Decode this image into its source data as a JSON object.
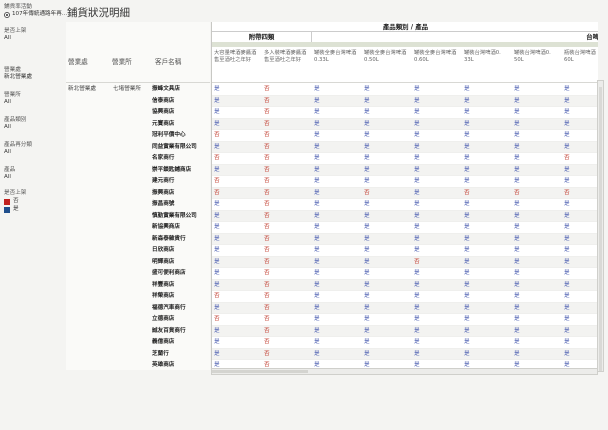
{
  "title": "鋪貨狀況明細",
  "filters": {
    "activity": {
      "label": "鋪貨率活動",
      "selected": "107年傳統通路年再..."
    },
    "launch": {
      "label": "是否上架",
      "value": "All"
    },
    "region": {
      "label": "營業處",
      "value": "新北營業處"
    },
    "office": {
      "label": "營業所",
      "value": "All"
    },
    "category": {
      "label": "產品類別",
      "value": "All"
    },
    "subcategory": {
      "label": "產品再分類",
      "value": "All"
    },
    "product": {
      "label": "產品",
      "value": "All"
    },
    "legend": {
      "label": "是否上架",
      "items": [
        {
          "label": "否",
          "color": "#c0211f"
        },
        {
          "label": "是",
          "color": "#1f4e8c"
        }
      ]
    }
  },
  "table": {
    "row_headers": [
      "營業處",
      "營業所",
      "客戶名稱"
    ],
    "region": "新北營業處",
    "office": "七堵營業所",
    "group_header": "產品類別 / 產品",
    "categories": [
      "附帶四類",
      "台啤"
    ],
    "products": [
      "大容量啤酒麥醬酒\n售至酒吐之年好",
      "多入裝啤酒麥醬酒\n售至酒吐之年好",
      "罐裝全麥台灣啤酒\n0.33L",
      "罐裝全麥台灣啤酒\n0.50L",
      "罐裝全麥台灣啤酒\n0.60L",
      "罐裝台灣啤酒0.\n33L",
      "罐裝台灣啤酒0.\n50L",
      "瓶裝台灣啤酒\n60L"
    ],
    "rows": [
      {
        "customer": "振峰文具店",
        "values": [
          "是",
          "否",
          "是",
          "是",
          "是",
          "是",
          "是",
          "是"
        ]
      },
      {
        "customer": "信泰商店",
        "values": [
          "是",
          "否",
          "是",
          "是",
          "是",
          "是",
          "是",
          "是"
        ]
      },
      {
        "customer": "協興商店",
        "values": [
          "是",
          "否",
          "是",
          "是",
          "是",
          "是",
          "是",
          "是"
        ]
      },
      {
        "customer": "元寶商店",
        "values": [
          "是",
          "否",
          "是",
          "是",
          "是",
          "是",
          "是",
          "是"
        ]
      },
      {
        "customer": "冠利平價中心",
        "values": [
          "否",
          "否",
          "是",
          "是",
          "是",
          "是",
          "是",
          "是"
        ]
      },
      {
        "customer": "同益實業有限公司",
        "values": [
          "是",
          "否",
          "是",
          "是",
          "是",
          "是",
          "是",
          "是"
        ]
      },
      {
        "customer": "名家商行",
        "values": [
          "否",
          "否",
          "是",
          "是",
          "是",
          "是",
          "是",
          "否"
        ]
      },
      {
        "customer": "崇平鎖匙鋪商店",
        "values": [
          "是",
          "否",
          "是",
          "是",
          "是",
          "是",
          "是",
          "是"
        ]
      },
      {
        "customer": "建元商行",
        "values": [
          "否",
          "否",
          "是",
          "是",
          "是",
          "是",
          "是",
          "是"
        ]
      },
      {
        "customer": "振興商店",
        "values": [
          "否",
          "否",
          "是",
          "否",
          "是",
          "否",
          "否",
          "否"
        ]
      },
      {
        "customer": "振昌商號",
        "values": [
          "是",
          "否",
          "是",
          "是",
          "是",
          "是",
          "是",
          "是"
        ]
      },
      {
        "customer": "慎勤實業有限公司",
        "values": [
          "是",
          "否",
          "是",
          "是",
          "是",
          "是",
          "是",
          "是"
        ]
      },
      {
        "customer": "新協興商店",
        "values": [
          "是",
          "否",
          "是",
          "是",
          "是",
          "是",
          "是",
          "是"
        ]
      },
      {
        "customer": "新森泰雜貨行",
        "values": [
          "是",
          "否",
          "是",
          "是",
          "是",
          "是",
          "是",
          "是"
        ]
      },
      {
        "customer": "日欣商店",
        "values": [
          "是",
          "否",
          "是",
          "是",
          "是",
          "是",
          "是",
          "是"
        ]
      },
      {
        "customer": "明輝商店",
        "values": [
          "是",
          "否",
          "是",
          "是",
          "否",
          "是",
          "是",
          "是"
        ]
      },
      {
        "customer": "盛可便利商店",
        "values": [
          "是",
          "否",
          "是",
          "是",
          "是",
          "是",
          "是",
          "是"
        ]
      },
      {
        "customer": "祥豐商店",
        "values": [
          "是",
          "否",
          "是",
          "是",
          "是",
          "是",
          "是",
          "是"
        ]
      },
      {
        "customer": "祥榮商店",
        "values": [
          "否",
          "否",
          "是",
          "是",
          "是",
          "是",
          "是",
          "是"
        ]
      },
      {
        "customer": "福德汽車商行",
        "values": [
          "是",
          "否",
          "是",
          "是",
          "是",
          "是",
          "是",
          "是"
        ]
      },
      {
        "customer": "立德商店",
        "values": [
          "否",
          "否",
          "是",
          "是",
          "是",
          "是",
          "是",
          "是"
        ]
      },
      {
        "customer": "誠友百貨商行",
        "values": [
          "是",
          "否",
          "是",
          "是",
          "是",
          "是",
          "是",
          "是"
        ]
      },
      {
        "customer": "義億商店",
        "values": [
          "是",
          "否",
          "是",
          "是",
          "是",
          "是",
          "是",
          "是"
        ]
      },
      {
        "customer": "芝蘭行",
        "values": [
          "是",
          "否",
          "是",
          "是",
          "是",
          "是",
          "是",
          "是"
        ]
      },
      {
        "customer": "英雄商店",
        "values": [
          "是",
          "否",
          "是",
          "是",
          "是",
          "是",
          "是",
          "是"
        ]
      }
    ]
  }
}
